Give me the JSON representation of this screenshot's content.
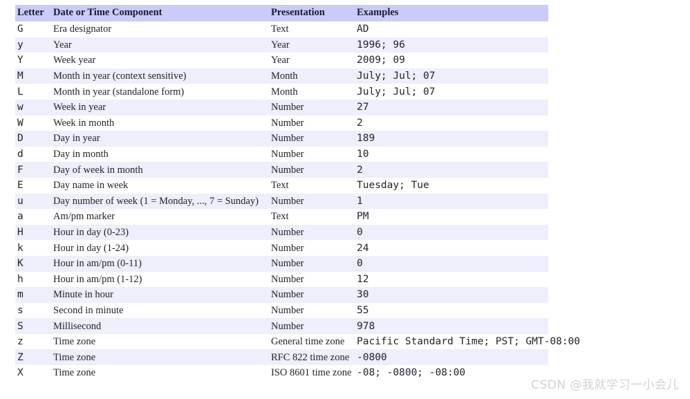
{
  "table": {
    "columns": [
      {
        "key": "letter",
        "label": "Letter"
      },
      {
        "key": "component",
        "label": "Date or Time Component"
      },
      {
        "key": "presentation",
        "label": "Presentation"
      },
      {
        "key": "examples",
        "label": "Examples"
      }
    ],
    "rows": [
      {
        "letter": "G",
        "component": "Era designator",
        "presentation": "Text",
        "examples": "AD"
      },
      {
        "letter": "y",
        "component": "Year",
        "presentation": "Year",
        "examples": "1996; 96"
      },
      {
        "letter": "Y",
        "component": "Week year",
        "presentation": "Year",
        "examples": "2009; 09"
      },
      {
        "letter": "M",
        "component": "Month in year (context sensitive)",
        "presentation": "Month",
        "examples": "July; Jul; 07"
      },
      {
        "letter": "L",
        "component": "Month in year (standalone form)",
        "presentation": "Month",
        "examples": "July; Jul; 07"
      },
      {
        "letter": "w",
        "component": "Week in year",
        "presentation": "Number",
        "examples": "27"
      },
      {
        "letter": "W",
        "component": "Week in month",
        "presentation": "Number",
        "examples": "2"
      },
      {
        "letter": "D",
        "component": "Day in year",
        "presentation": "Number",
        "examples": "189"
      },
      {
        "letter": "d",
        "component": "Day in month",
        "presentation": "Number",
        "examples": "10"
      },
      {
        "letter": "F",
        "component": "Day of week in month",
        "presentation": "Number",
        "examples": "2"
      },
      {
        "letter": "E",
        "component": "Day name in week",
        "presentation": "Text",
        "examples": "Tuesday; Tue"
      },
      {
        "letter": "u",
        "component": "Day number of week (1 = Monday, ..., 7 = Sunday)",
        "presentation": "Number",
        "examples": "1"
      },
      {
        "letter": "a",
        "component": "Am/pm marker",
        "presentation": "Text",
        "examples": "PM"
      },
      {
        "letter": "H",
        "component": "Hour in day (0-23)",
        "presentation": "Number",
        "examples": "0"
      },
      {
        "letter": "k",
        "component": "Hour in day (1-24)",
        "presentation": "Number",
        "examples": "24"
      },
      {
        "letter": "K",
        "component": "Hour in am/pm (0-11)",
        "presentation": "Number",
        "examples": "0"
      },
      {
        "letter": "h",
        "component": "Hour in am/pm (1-12)",
        "presentation": "Number",
        "examples": "12"
      },
      {
        "letter": "m",
        "component": "Minute in hour",
        "presentation": "Number",
        "examples": "30"
      },
      {
        "letter": "s",
        "component": "Second in minute",
        "presentation": "Number",
        "examples": "55"
      },
      {
        "letter": "S",
        "component": "Millisecond",
        "presentation": "Number",
        "examples": "978"
      },
      {
        "letter": "z",
        "component": "Time zone",
        "presentation": "General time zone",
        "examples": "Pacific Standard Time; PST; GMT-08:00"
      },
      {
        "letter": "Z",
        "component": "Time zone",
        "presentation": "RFC 822 time zone",
        "examples": "-0800"
      },
      {
        "letter": "X",
        "component": "Time zone",
        "presentation": "ISO 8601 time zone",
        "examples": "-08; -0800; -08:00"
      }
    ]
  },
  "watermark": {
    "text": "CSDN @我就学习一小会儿"
  },
  "colors": {
    "header_background": "#cbcbfa",
    "stripe_background": "#eeeefc",
    "presentation_text": "#44679a",
    "body_text": "#23232b",
    "watermark_text": "#d2d2d2"
  }
}
